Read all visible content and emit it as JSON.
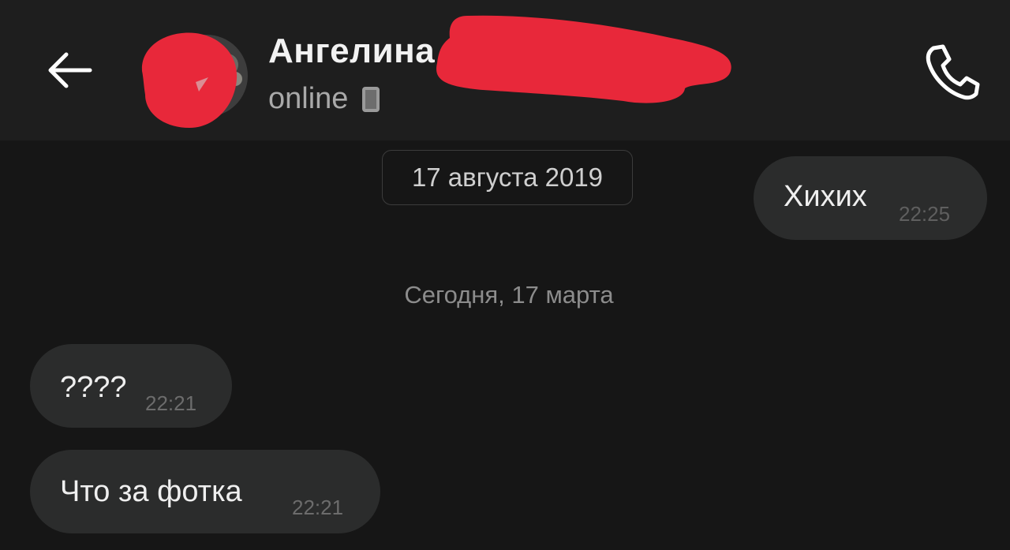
{
  "header": {
    "contact_name": "Ангелина",
    "status": "online",
    "back_icon": "arrow-left-icon",
    "call_icon": "phone-icon",
    "device_icon": "mobile-device-icon"
  },
  "chat": {
    "date_chip": "17 августа 2019",
    "date_separator": "Сегодня, 17 марта",
    "messages": [
      {
        "direction": "outgoing",
        "text": "Хихих",
        "time": "22:25"
      },
      {
        "direction": "incoming",
        "text": "????",
        "time": "22:21"
      },
      {
        "direction": "incoming",
        "text": "Что за фотка",
        "time": "22:21"
      }
    ]
  },
  "colors": {
    "background": "#161616",
    "header_background": "#1e1e1e",
    "bubble": "#2b2c2c",
    "redaction": "#e8283a"
  }
}
